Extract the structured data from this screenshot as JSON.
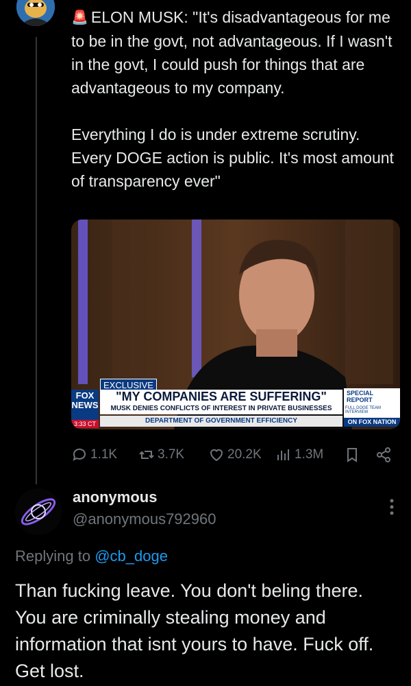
{
  "post": {
    "text": "ELON MUSK: \"It's disadvantageous for me to be in the govt, not advantageous. If I wasn't in the govt, I could push for things that are advantageous to my company.\n\nEverything I do is under extreme scrutiny. Every DOGE action is public. It's most amount of transparency ever\"",
    "emoji_icon": "siren-icon",
    "media": {
      "network_top": "FOX",
      "network_bottom": "NEWS",
      "time": "3:33 CT",
      "tag": "EXCLUSIVE",
      "headline": "\"MY COMPANIES ARE SUFFERING\"",
      "subhead": "MUSK DENIES CONFLICTS OF INTEREST IN PRIVATE BUSINESSES",
      "ticker": "DEPARTMENT OF GOVERNMENT EFFICIENCY",
      "side_special": "SPECIAL",
      "side_report": "REPORT",
      "side_line": "FULL DOGE TEAM INTERVIEW",
      "side_nation": "ON FOX NATION"
    },
    "stats": {
      "replies": "1.1K",
      "reposts": "3.7K",
      "likes": "20.2K",
      "views": "1.3M"
    }
  },
  "reply": {
    "name": "anonymous",
    "handle": "@anonymous792960",
    "replying_prefix": "Replying to ",
    "replying_to": "@cb_doge",
    "text": "Than fucking leave. You don't beling there. You are criminally stealing money and information that isnt yours to have. Fuck off. Get lost."
  },
  "colors": {
    "background": "#000000",
    "text": "#e7e9ea",
    "muted": "#71767b",
    "link": "#1d9bf0",
    "fox_red": "#c8102e",
    "fox_blue": "#0a3a82"
  }
}
